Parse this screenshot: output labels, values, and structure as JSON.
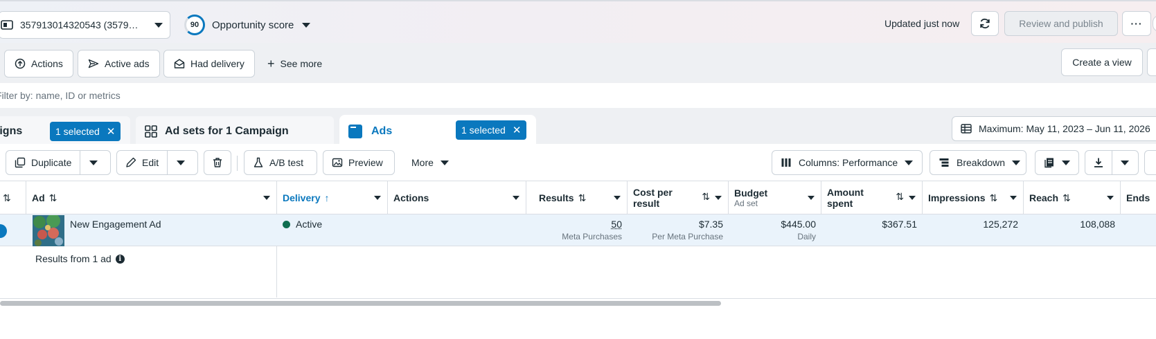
{
  "topbar": {
    "account_label": "357913014320543 (3579…",
    "opportunity_score": "90",
    "opportunity_label": "Opportunity score",
    "updated_text": "Updated just now",
    "review_publish_label": "Review and publish",
    "more_label": "···"
  },
  "filters": {
    "chips": [
      "Actions",
      "Active ads",
      "Had delivery"
    ],
    "see_more_label": "See more",
    "create_view_label": "Create a view"
  },
  "search": {
    "placeholder": "Filter by: name, ID or metrics"
  },
  "tabs": {
    "campaigns_label": "Campaigns",
    "campaigns_selected": "1 selected",
    "adsets_label": "Ad sets for 1 Campaign",
    "ads_label": "Ads",
    "ads_selected": "1 selected",
    "date_range_label": "Maximum: May 11, 2023 – Jun 11, 2026"
  },
  "toolbar": {
    "duplicate_label": "Duplicate",
    "edit_label": "Edit",
    "ab_test_label": "A/B test",
    "preview_label": "Preview",
    "more_label": "More",
    "columns_label": "Columns: Performance",
    "breakdown_label": "Breakdown"
  },
  "table": {
    "headers": {
      "ad": "Ad",
      "delivery": "Delivery",
      "actions": "Actions",
      "results": "Results",
      "cost_per_result_1": "Cost per",
      "cost_per_result_2": "result",
      "budget": "Budget",
      "budget_sub": "Ad set",
      "amount_spent_1": "Amount",
      "amount_spent_2": "spent",
      "impressions": "Impressions",
      "reach": "Reach",
      "ends": "Ends"
    },
    "row": {
      "ad_name": "New Engagement Ad",
      "delivery": "Active",
      "results": "50",
      "results_sub": "Meta Purchases",
      "cost_per_result": "$7.35",
      "cost_per_result_sub": "Per Meta Purchase",
      "budget": "$445.00",
      "budget_sub": "Daily",
      "amount_spent": "$367.51",
      "impressions": "125,272",
      "reach": "108,088"
    },
    "footer_text": "Results from 1 ad"
  },
  "colors": {
    "accent": "#0a78be",
    "active_dot": "#0f6e50",
    "row_highlight": "#eaf3fb"
  }
}
